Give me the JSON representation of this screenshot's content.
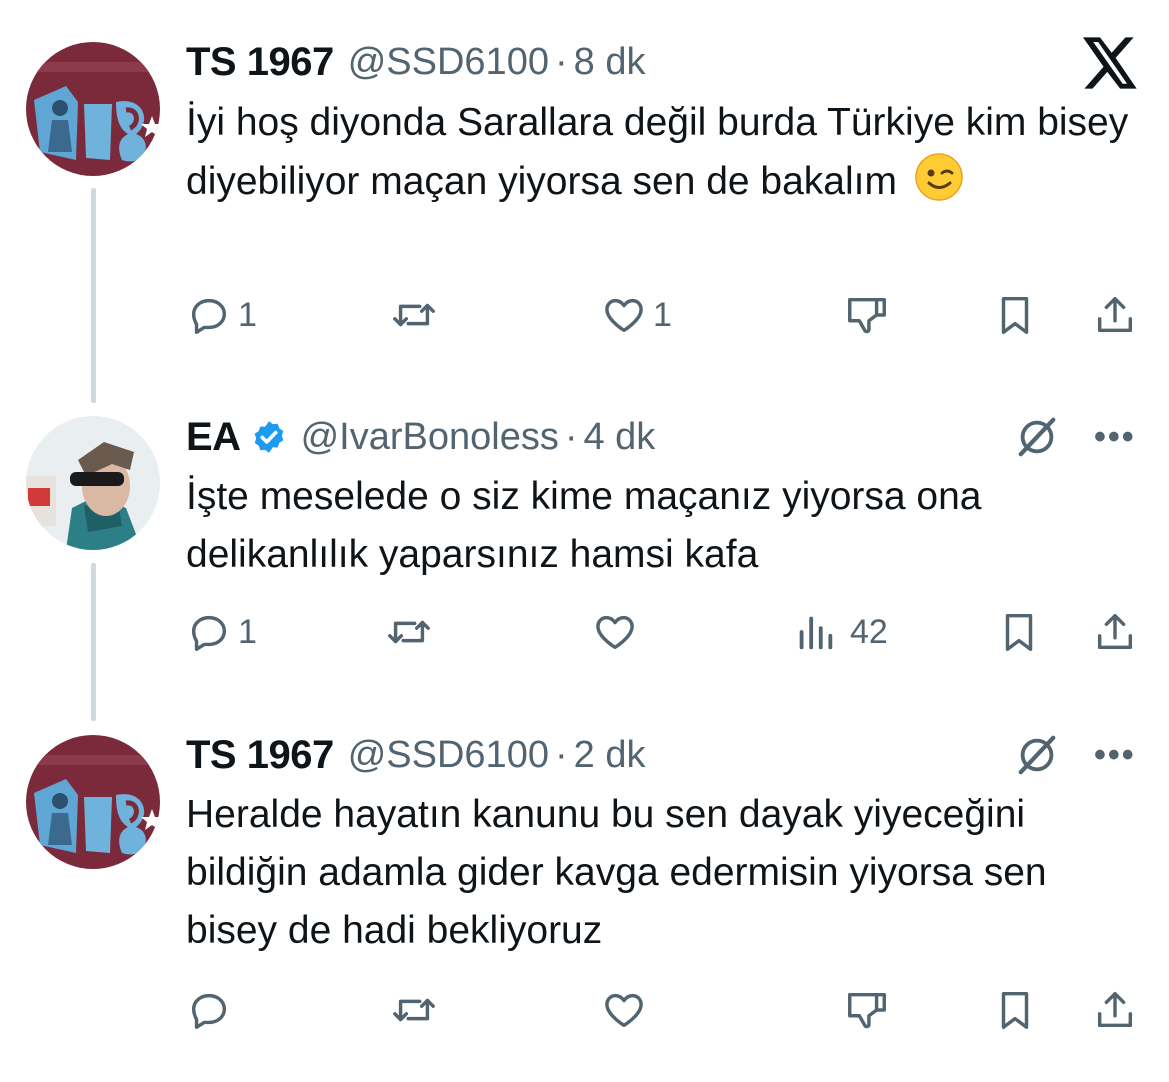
{
  "tweets": [
    {
      "name": "TS 1967",
      "handle": "@SSD6100",
      "time": "8 dk",
      "text": "İyi hoş diyonda Sarallara değil burda Türkiye kim bisey diyebiliyor maçan yiyorsa sen de bakalım",
      "emoji": "winking-face",
      "replies": "1",
      "likes": "1"
    },
    {
      "name": "EA",
      "handle": "@IvarBonoless",
      "time": "4 dk",
      "verified": true,
      "text": "İşte meselede o siz kime maçanız yiyorsa ona delikanlılık yaparsınız hamsi kafa",
      "replies": "1",
      "views": "42"
    },
    {
      "name": "TS 1967",
      "handle": "@SSD6100",
      "time": "2 dk",
      "text": "Heralde hayatın kanunu bu sen dayak yiyeceğini bildiğin adamla gider kavga edermisin yiyorsa sen bisey de hadi bekliyoruz"
    }
  ],
  "separator": "·",
  "more_glyph": "•••",
  "colors": {
    "text": "#0f1419",
    "muted": "#536471",
    "thread_line": "#cfd9de",
    "verified": "#1d9bf0",
    "avatar_maroon": "#7a2a3b",
    "avatar_blue": "#6fb3dc"
  }
}
